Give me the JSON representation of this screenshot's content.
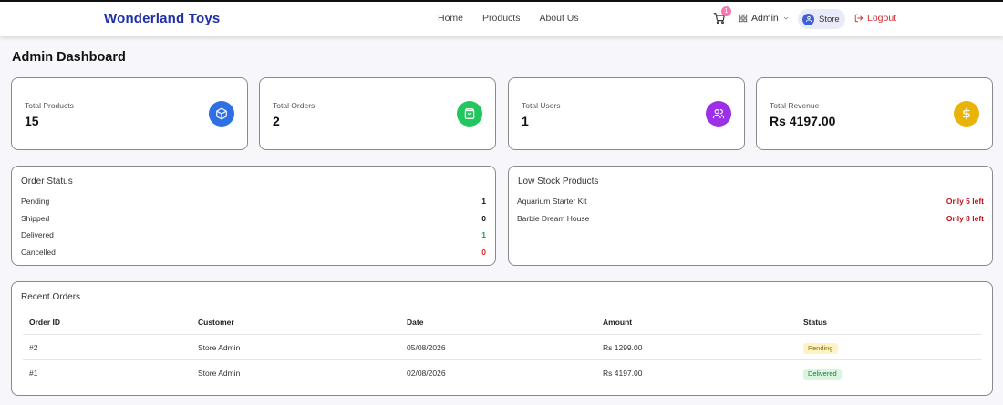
{
  "nav": {
    "brand": "Wonderland Toys",
    "links": [
      "Home",
      "Products",
      "About Us"
    ],
    "cart_count": "1",
    "admin_label": "Admin",
    "store_label": "Store",
    "logout_label": "Logout",
    "brand_color": "#1f2fa6",
    "logout_color": "#d32f2f"
  },
  "page": {
    "title": "Admin Dashboard"
  },
  "stats": [
    {
      "label": "Total Products",
      "value": "15",
      "icon": "package-icon",
      "color": "#2f6fe4"
    },
    {
      "label": "Total Orders",
      "value": "2",
      "icon": "shopping-bag-icon",
      "color": "#22c55e"
    },
    {
      "label": "Total Users",
      "value": "1",
      "icon": "users-icon",
      "color": "#9b30e6"
    },
    {
      "label": "Total Revenue",
      "value": "Rs 4197.00",
      "icon": "dollar-icon",
      "color": "#eab308"
    }
  ],
  "order_status": {
    "title": "Order Status",
    "rows": [
      {
        "label": "Pending",
        "count": "1",
        "color": "#111111"
      },
      {
        "label": "Shipped",
        "count": "0",
        "color": "#111111"
      },
      {
        "label": "Delivered",
        "count": "1",
        "color": "#16a34a"
      },
      {
        "label": "Cancelled",
        "count": "0",
        "color": "#dc2626"
      }
    ]
  },
  "low_stock": {
    "title": "Low Stock Products",
    "items": [
      {
        "name": "Aquarium Starter Kit",
        "left": "Only 5 left"
      },
      {
        "name": "Barbie Dream House",
        "left": "Only 8 left"
      }
    ]
  },
  "recent_orders": {
    "title": "Recent Orders",
    "columns": [
      "Order ID",
      "Customer",
      "Date",
      "Amount",
      "Status"
    ],
    "rows": [
      {
        "id": "#2",
        "customer": "Store Admin",
        "date": "05/08/2026",
        "amount": "Rs 1299.00",
        "status": "Pending",
        "status_bg": "#fdf3c4",
        "status_fg": "#8a6d00"
      },
      {
        "id": "#1",
        "customer": "Store Admin",
        "date": "02/08/2026",
        "amount": "Rs 4197.00",
        "status": "Delivered",
        "status_bg": "#d9f5e0",
        "status_fg": "#1e7a3a"
      }
    ]
  }
}
